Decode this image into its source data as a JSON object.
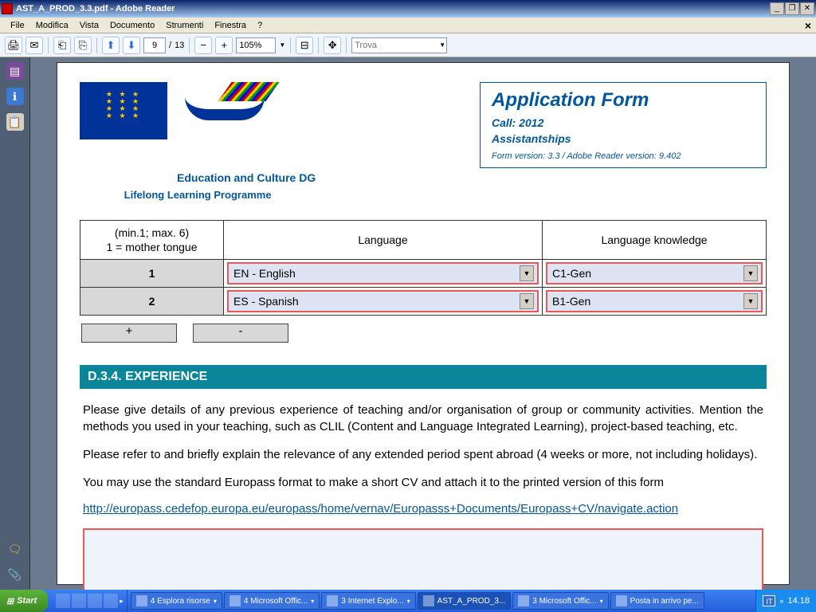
{
  "window": {
    "title": "AST_A_PROD_3.3.pdf - Adobe Reader"
  },
  "menu": {
    "file": "File",
    "edit": "Modifica",
    "view": "Vista",
    "document": "Documento",
    "tools": "Strumenti",
    "window": "Finestra",
    "help": "?"
  },
  "toolbar": {
    "page_current": "9",
    "page_sep": "/",
    "page_total": "13",
    "zoom": "105%",
    "find_placeholder": "Trova"
  },
  "doc": {
    "logo_line": "Education and Culture DG",
    "subtitle": "Lifelong Learning Programme",
    "form_title": "Application Form",
    "form_call": "Call: 2012",
    "form_kind": "Assistantships",
    "form_version": "Form version: 3.3 / Adobe Reader version: 9.402",
    "th_num": "(min.1; max. 6)\n1 = mother tongue",
    "th_lang": "Language",
    "th_know": "Language knowledge",
    "rows": [
      {
        "n": "1",
        "lang": "EN - English",
        "know": "C1-Gen"
      },
      {
        "n": "2",
        "lang": "ES - Spanish",
        "know": "B1-Gen"
      }
    ],
    "btn_add": "+",
    "btn_remove": "-",
    "section": "D.3.4. EXPERIENCE",
    "p1": "Please give details of any previous experience of teaching and/or organisation of group or community activities. Mention the methods you used in your teaching, such as CLIL (Content and Language Integrated Learning), project-based teaching, etc.",
    "p2": "Please refer to and briefly explain the relevance of any extended period spent abroad (4 weeks or more, not including holidays).",
    "p3": "You may use the standard Europass format to make a short CV and attach it to the printed version of this form",
    "link": "http://europass.cedefop.europa.eu/europass/home/vernav/Europasss+Documents/Europass+CV/navigate.action"
  },
  "taskbar": {
    "start": "Start",
    "tasks": [
      {
        "label": "4 Esplora risorse"
      },
      {
        "label": "4 Microsoft Offic..."
      },
      {
        "label": "3 Internet Explo..."
      },
      {
        "label": "AST_A_PROD_3...",
        "active": true
      },
      {
        "label": "3 Microsoft Offic..."
      },
      {
        "label": "Posta in arrivo pe..."
      }
    ],
    "lang": "IT",
    "time": "14.18"
  }
}
